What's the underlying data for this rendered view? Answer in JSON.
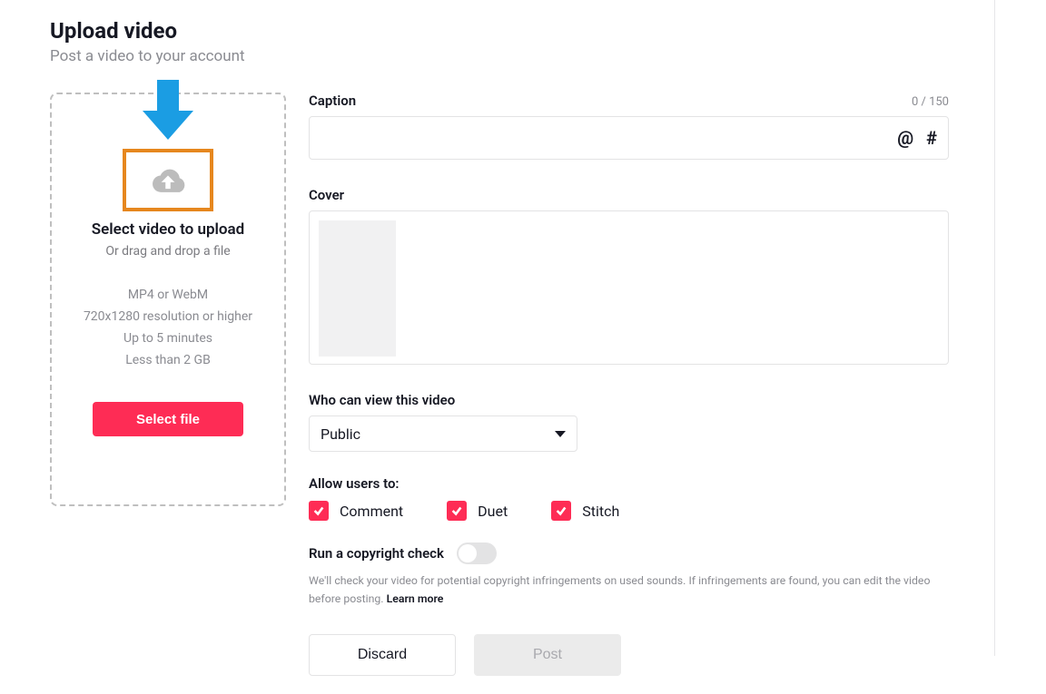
{
  "header": {
    "title": "Upload video",
    "subtitle": "Post a video to your account"
  },
  "upload": {
    "title": "Select video to upload",
    "subtitle": "Or drag and drop a file",
    "hints": [
      "MP4 or WebM",
      "720x1280 resolution or higher",
      "Up to 5 minutes",
      "Less than 2 GB"
    ],
    "button_label": "Select file"
  },
  "caption": {
    "label": "Caption",
    "count": "0 / 150",
    "value": "",
    "mention_symbol": "@",
    "hashtag_symbol": "#"
  },
  "cover": {
    "label": "Cover"
  },
  "privacy": {
    "label": "Who can view this video",
    "selected": "Public"
  },
  "allow": {
    "label": "Allow users to:",
    "options": [
      {
        "label": "Comment",
        "checked": true
      },
      {
        "label": "Duet",
        "checked": true
      },
      {
        "label": "Stitch",
        "checked": true
      }
    ]
  },
  "copyright": {
    "label": "Run a copyright check",
    "on": false,
    "description_prefix": "We'll check your video for potential copyright infringements on used sounds. If infringements are found, you can edit the video before posting. ",
    "learn_more": "Learn more"
  },
  "actions": {
    "discard": "Discard",
    "post": "Post"
  }
}
